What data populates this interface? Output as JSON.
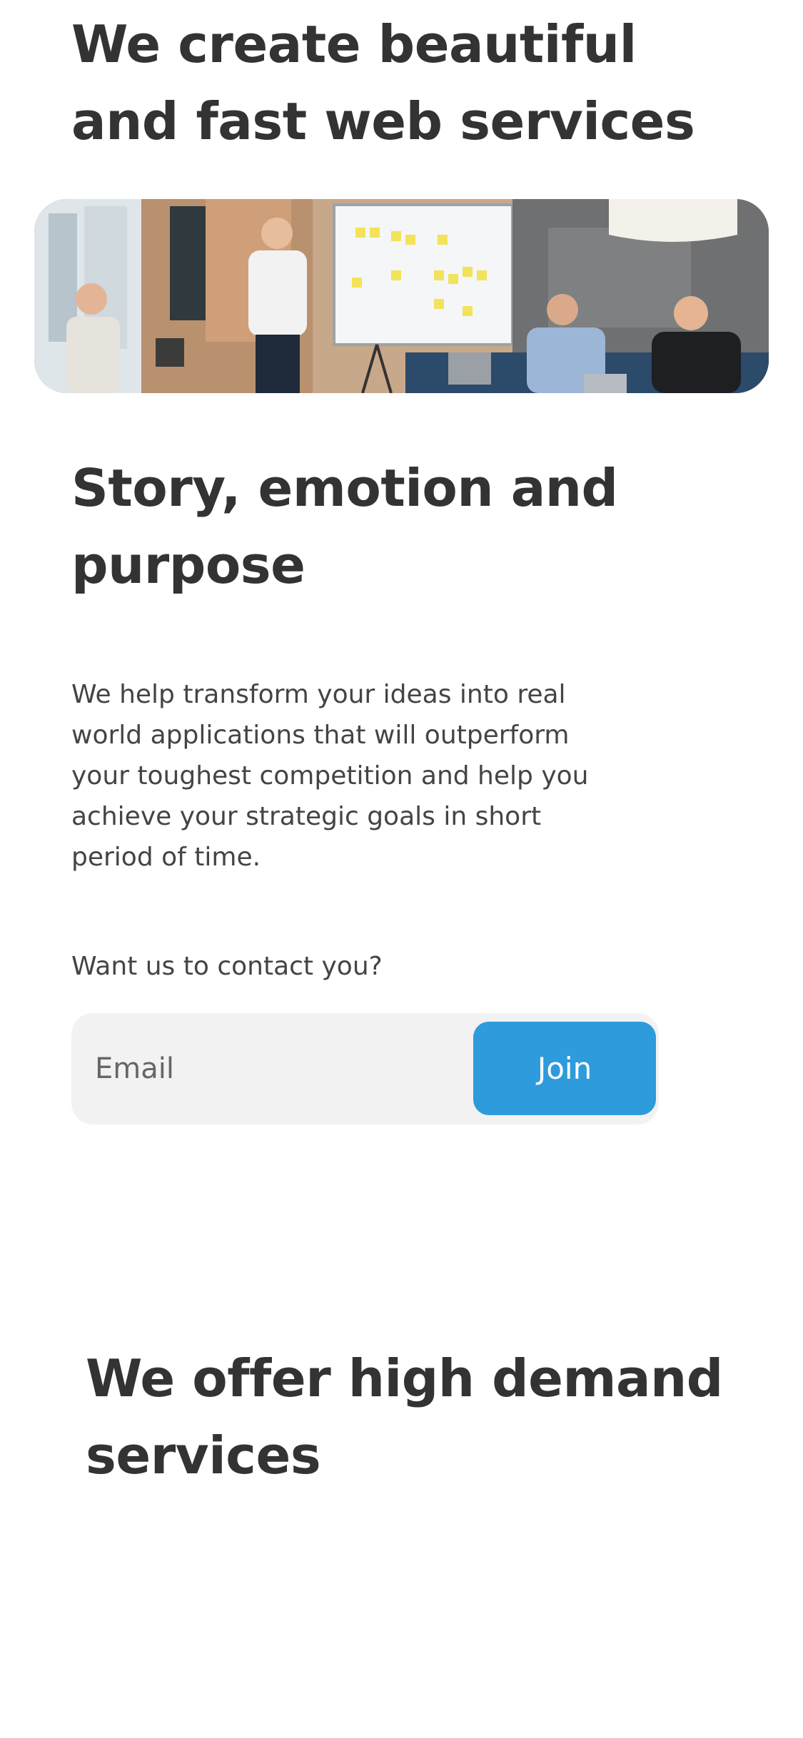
{
  "hero": {
    "title": "We create beautiful and fast web services"
  },
  "hero_image": {
    "icon": "team-meeting-photo"
  },
  "story": {
    "title": "Story, emotion and purpose",
    "body": "We help transform your ideas into real world applications that will outperform your toughest competition and help you achieve your strategic goals in short period of time."
  },
  "contact": {
    "prompt": "Want us to contact you?",
    "email_placeholder": "Email",
    "join_label": "Join",
    "accent_color": "#2d9bdc"
  },
  "offer": {
    "title": "We offer high demand services"
  }
}
